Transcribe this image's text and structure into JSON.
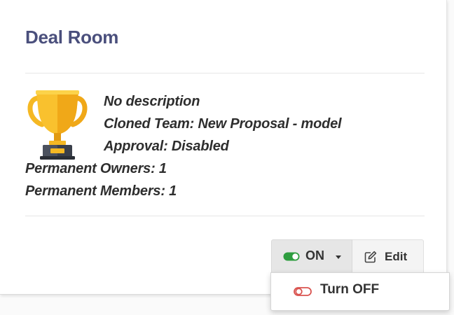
{
  "card": {
    "title": "Deal Room",
    "icon": "trophy-icon",
    "details": {
      "description": "No description",
      "cloned_team": "Cloned Team: New Proposal - model",
      "approval": "Approval: Disabled",
      "permanent_owners": "Permanent Owners: 1",
      "permanent_members": "Permanent Members: 1"
    }
  },
  "actions": {
    "toggle": {
      "label": "ON",
      "icon": "toggle-on-icon",
      "state_color": "#2e9d3f"
    },
    "edit": {
      "label": "Edit",
      "icon": "edit-icon"
    }
  },
  "dropdown": {
    "items": [
      {
        "label": "Turn OFF",
        "icon": "toggle-off-icon",
        "icon_color": "#d9534f"
      }
    ]
  },
  "colors": {
    "title": "#4a4f7c",
    "trophy_gold": "#f5b823"
  }
}
